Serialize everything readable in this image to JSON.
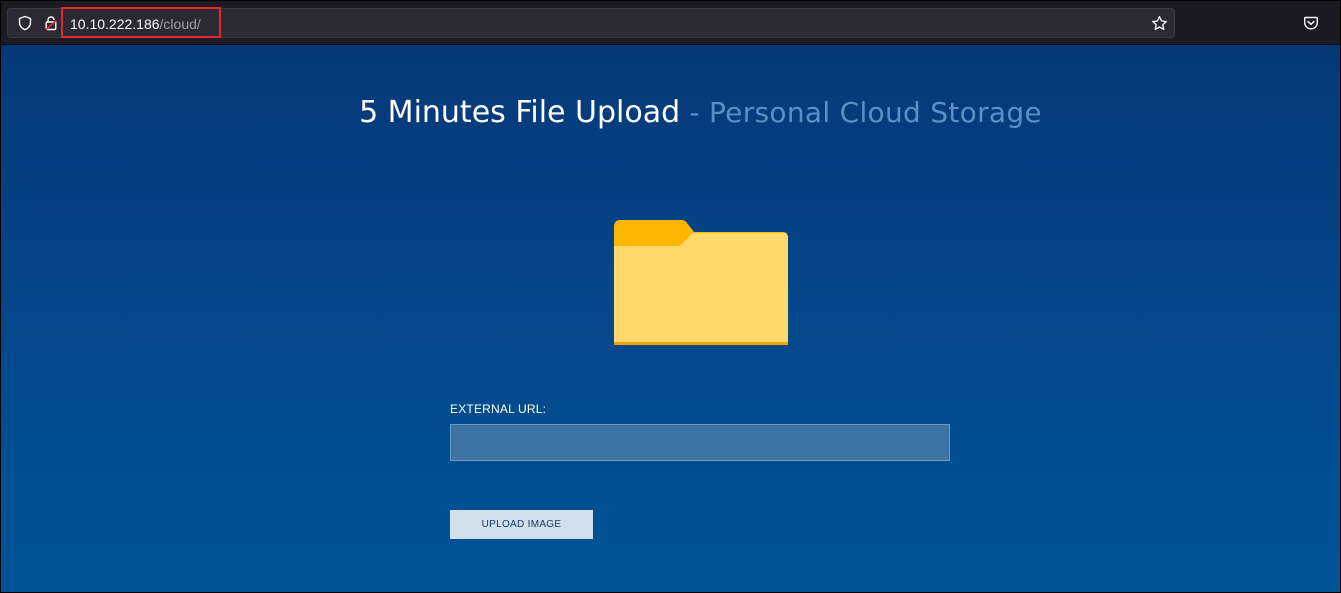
{
  "browser": {
    "url_host": "10.10.222.186",
    "url_path": "/cloud/",
    "icons": {
      "shield": "shield-icon",
      "lock": "lock-icon",
      "bookmark": "star-icon",
      "pocket": "pocket-icon"
    },
    "highlight_color": "#e0282e"
  },
  "page": {
    "title_main": "5 Minutes File Upload",
    "title_sub": " - Personal Cloud Storage",
    "folder_icon": "folder-icon",
    "form": {
      "field_label": "EXTERNAL URL:",
      "field_value": "",
      "button_label": "UPLOAD IMAGE"
    },
    "colors": {
      "background_top": "#063878",
      "background_bottom": "#005596",
      "button_bg": "#d1dfea",
      "input_bg": "#3d73a2"
    }
  }
}
